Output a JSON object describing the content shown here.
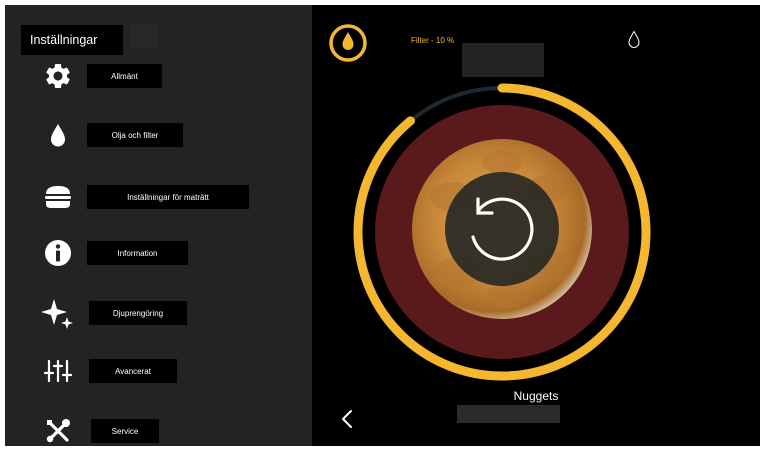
{
  "sidebar": {
    "title": "Inställningar",
    "items": [
      {
        "label": "Allmänt",
        "icon": "gear-icon"
      },
      {
        "label": "Olja och filter",
        "icon": "oil-drop-icon"
      },
      {
        "label": "Inställningar för maträtt",
        "icon": "burger-icon"
      },
      {
        "label": "Information",
        "icon": "info-icon"
      },
      {
        "label": "Djuprengöring",
        "icon": "sparkle-icon"
      },
      {
        "label": "Avancerat",
        "icon": "sliders-icon"
      },
      {
        "label": "Service",
        "icon": "tools-icon"
      }
    ]
  },
  "status": {
    "filter_text": "Filter - 10 %"
  },
  "product": {
    "name": "Nuggets",
    "progress_fraction": 0.89
  },
  "colors": {
    "accent": "#f5b72f",
    "sidebar_bg": "#232325",
    "dial_inner": "#5a1a1c",
    "background": "#000000"
  }
}
